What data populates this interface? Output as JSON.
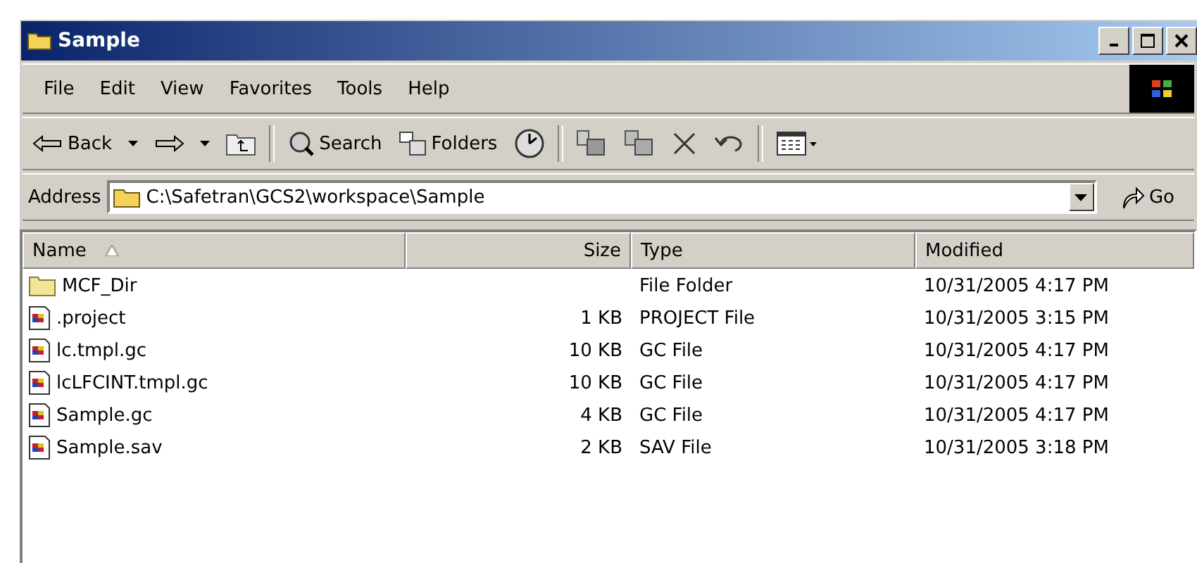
{
  "window": {
    "title": "Sample"
  },
  "menu": [
    "File",
    "Edit",
    "View",
    "Favorites",
    "Tools",
    "Help"
  ],
  "toolbar": [
    {
      "kind": "back",
      "label": "Back"
    },
    {
      "kind": "dropdown"
    },
    {
      "kind": "forward"
    },
    {
      "kind": "dropdown"
    },
    {
      "kind": "up"
    },
    {
      "kind": "separator"
    },
    {
      "kind": "search",
      "label": "Search"
    },
    {
      "kind": "folders",
      "label": "Folders"
    },
    {
      "kind": "history"
    },
    {
      "kind": "separator"
    },
    {
      "kind": "move"
    },
    {
      "kind": "copy"
    },
    {
      "kind": "delete"
    },
    {
      "kind": "undo"
    },
    {
      "kind": "separator"
    },
    {
      "kind": "views"
    }
  ],
  "address": {
    "label": "Address",
    "value": "C:\\Safetran\\GCS2\\workspace\\Sample",
    "go": "Go"
  },
  "columns": [
    {
      "label": "Name",
      "sorted": true
    },
    {
      "label": "Size",
      "sorted": false
    },
    {
      "label": "Type",
      "sorted": false
    },
    {
      "label": "Modified",
      "sorted": false
    }
  ],
  "rows": [
    {
      "kind": "folder",
      "name": "MCF_Dir",
      "size": "",
      "type": "File Folder",
      "modified": "10/31/2005 4:17 PM"
    },
    {
      "kind": "file",
      "name": ".project",
      "size": "1 KB",
      "type": "PROJECT File",
      "modified": "10/31/2005 3:15 PM"
    },
    {
      "kind": "file",
      "name": "lc.tmpl.gc",
      "size": "10 KB",
      "type": "GC File",
      "modified": "10/31/2005 4:17 PM"
    },
    {
      "kind": "file",
      "name": "lcLFCINT.tmpl.gc",
      "size": "10 KB",
      "type": "GC File",
      "modified": "10/31/2005 4:17 PM"
    },
    {
      "kind": "file",
      "name": "Sample.gc",
      "size": "4 KB",
      "type": "GC File",
      "modified": "10/31/2005 4:17 PM"
    },
    {
      "kind": "file",
      "name": "Sample.sav",
      "size": "2 KB",
      "type": "SAV File",
      "modified": "10/31/2005 3:18 PM"
    }
  ]
}
